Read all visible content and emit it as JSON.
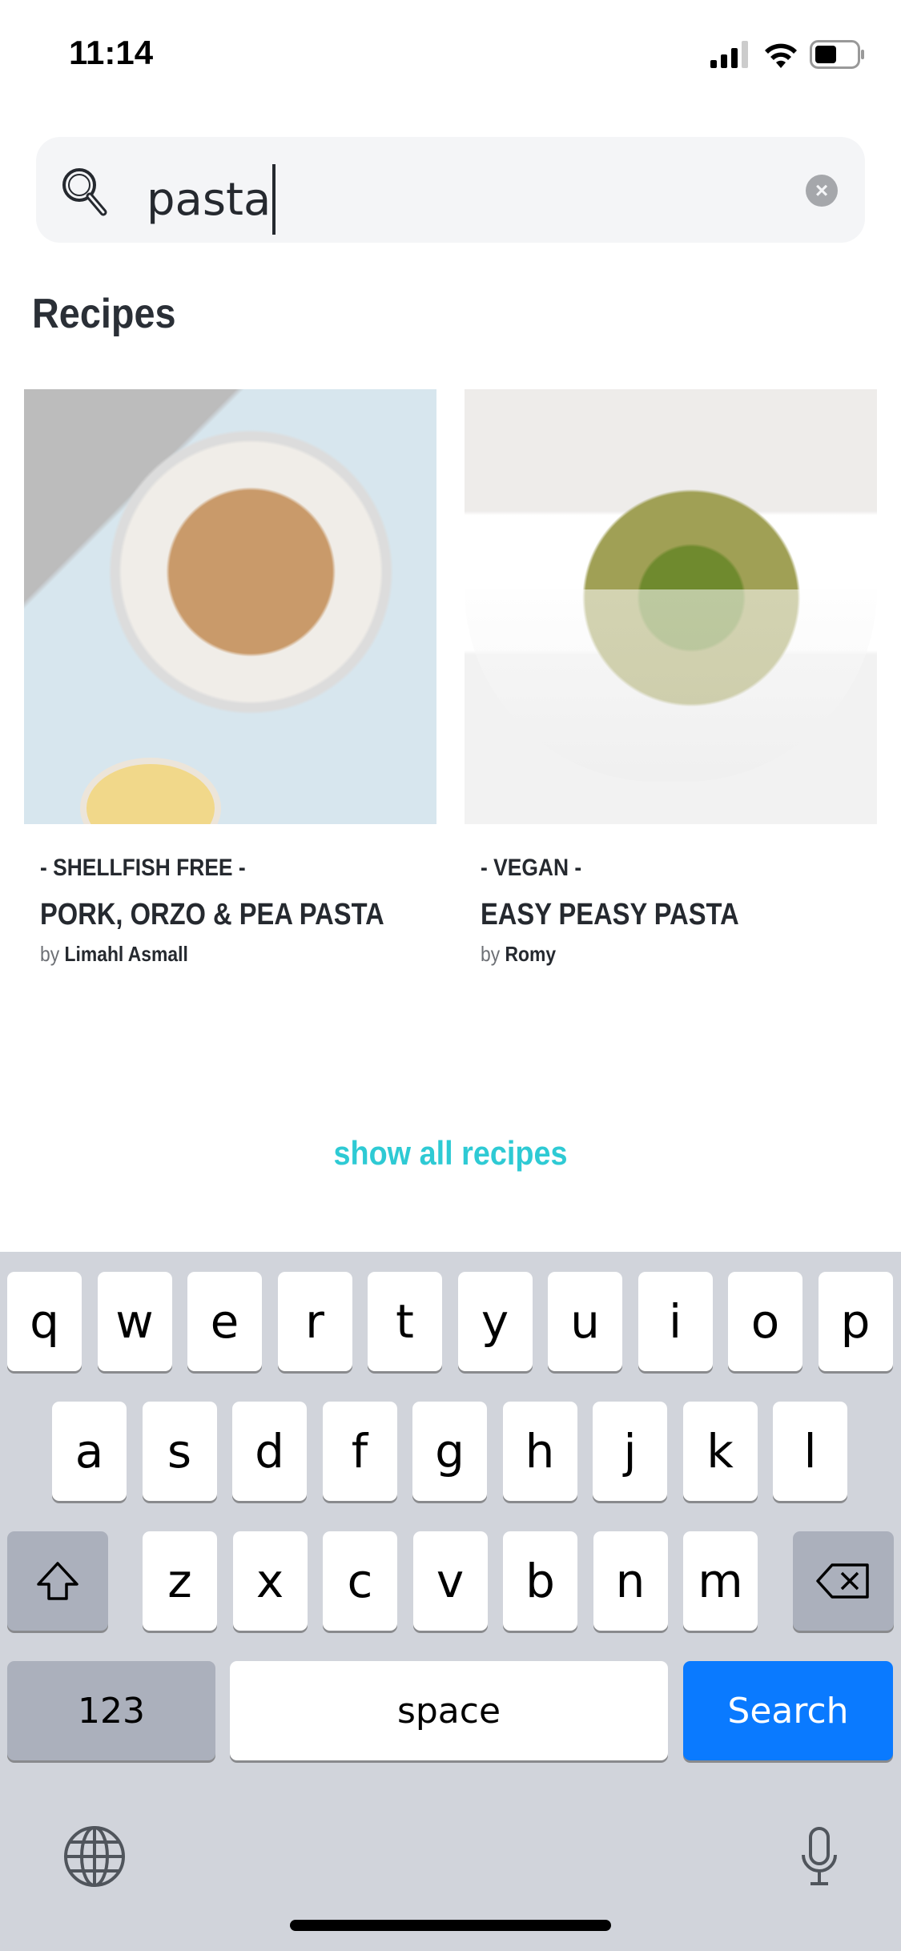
{
  "status_bar": {
    "time": "11:14"
  },
  "search": {
    "value": "pasta",
    "icon": "magnifier-icon",
    "clear_icon": "clear-icon"
  },
  "section": {
    "heading": "Recipes",
    "show_all": "show all recipes"
  },
  "recipes": [
    {
      "tag": "- SHELLFISH FREE -",
      "title": "PORK, ORZO & PEA PASTA",
      "by": "by",
      "author": "Limahl Asmall"
    },
    {
      "tag": "- VEGAN -",
      "title": "EASY PEASY PASTA",
      "by": "by",
      "author": "Romy"
    }
  ],
  "keyboard": {
    "row1": [
      "q",
      "w",
      "e",
      "r",
      "t",
      "y",
      "u",
      "i",
      "o",
      "p"
    ],
    "row2": [
      "a",
      "s",
      "d",
      "f",
      "g",
      "h",
      "j",
      "k",
      "l"
    ],
    "row3": [
      "z",
      "x",
      "c",
      "v",
      "b",
      "n",
      "m"
    ],
    "numbers": "123",
    "space": "space",
    "search": "Search"
  },
  "colors": {
    "accent": "#2ecad4",
    "search_key": "#0a7aff",
    "keyboard_bg": "#d1d4db"
  }
}
